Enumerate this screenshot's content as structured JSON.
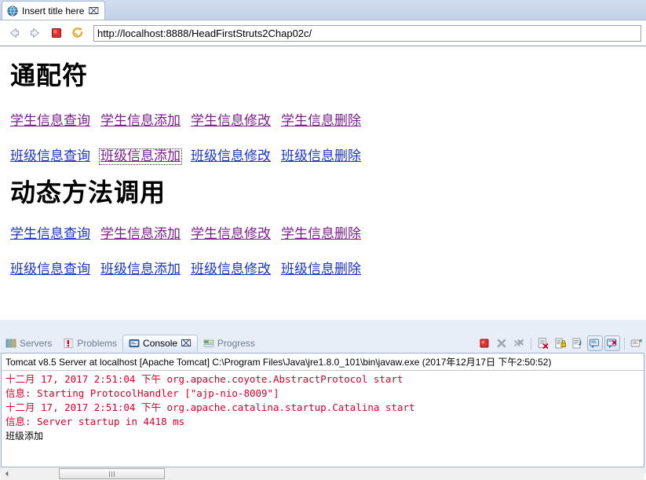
{
  "browser": {
    "tab_title": "Insert title here",
    "tab_close_glyph": "⌧",
    "url": "http://localhost:8888/HeadFirstStruts2Chap02c/",
    "toolbar": {
      "back_label": "Back",
      "forward_label": "Forward",
      "stop_label": "Stop",
      "refresh_label": "Refresh"
    }
  },
  "page": {
    "heading1": "通配符",
    "heading2": "动态方法调用",
    "rows": [
      {
        "id": "wildcard-student",
        "links": [
          {
            "text": "学生信息查询",
            "state": "visited",
            "focused": false
          },
          {
            "text": "学生信息添加",
            "state": "visited",
            "focused": false
          },
          {
            "text": "学生信息修改",
            "state": "visited",
            "focused": false
          },
          {
            "text": "学生信息删除",
            "state": "visited",
            "focused": false
          }
        ]
      },
      {
        "id": "wildcard-class",
        "links": [
          {
            "text": "班级信息查询",
            "state": "unvisited",
            "focused": false
          },
          {
            "text": "班级信息添加",
            "state": "visited",
            "focused": true
          },
          {
            "text": "班级信息修改",
            "state": "unvisited",
            "focused": false
          },
          {
            "text": "班级信息删除",
            "state": "unvisited",
            "focused": false
          }
        ]
      },
      {
        "id": "dmi-student",
        "links": [
          {
            "text": "学生信息查询",
            "state": "unvisited",
            "focused": false
          },
          {
            "text": "学生信息添加",
            "state": "visited",
            "focused": false
          },
          {
            "text": "学生信息修改",
            "state": "visited",
            "focused": false
          },
          {
            "text": "学生信息删除",
            "state": "visited",
            "focused": false
          }
        ]
      },
      {
        "id": "dmi-class",
        "links": [
          {
            "text": "班级信息查询",
            "state": "unvisited",
            "focused": false
          },
          {
            "text": "班级信息添加",
            "state": "unvisited",
            "focused": false
          },
          {
            "text": "班级信息修改",
            "state": "unvisited",
            "focused": false
          },
          {
            "text": "班级信息删除",
            "state": "unvisited",
            "focused": false
          }
        ]
      }
    ],
    "link_colors": {
      "unvisited": "#1a35c8",
      "visited": "#7d1f8e"
    }
  },
  "console_view": {
    "tabs": [
      {
        "label": "Servers",
        "icon": "servers-icon",
        "active": false
      },
      {
        "label": "Problems",
        "icon": "problems-icon",
        "active": false
      },
      {
        "label": "Console",
        "icon": "console-icon",
        "active": true
      },
      {
        "label": "Progress",
        "icon": "progress-icon",
        "active": false
      }
    ],
    "active_tab_close_glyph": "⌧",
    "toolbar": [
      {
        "name": "terminate-button",
        "label": "Terminate",
        "enabled": true,
        "toggled": false
      },
      {
        "name": "remove-launch-button",
        "label": "Remove Launch",
        "enabled": false,
        "toggled": false
      },
      {
        "name": "remove-all-terminated-button",
        "label": "Remove All Terminated Launches",
        "enabled": false,
        "toggled": false
      },
      {
        "name": "clear-console-button",
        "label": "Clear Console",
        "enabled": true,
        "toggled": false
      },
      {
        "name": "scroll-lock-button",
        "label": "Scroll Lock",
        "enabled": true,
        "toggled": false
      },
      {
        "name": "word-wrap-button",
        "label": "Word Wrap",
        "enabled": true,
        "toggled": false
      },
      {
        "name": "pin-console-button",
        "label": "Pin Console",
        "enabled": true,
        "toggled": true
      },
      {
        "name": "display-selected-console-button",
        "label": "Display Selected Console",
        "enabled": true,
        "toggled": true
      },
      {
        "name": "open-console-button",
        "label": "Open Console",
        "enabled": true,
        "toggled": false
      }
    ],
    "header": "Tomcat v8.5 Server at localhost [Apache Tomcat] C:\\Program Files\\Java\\jre1.8.0_101\\bin\\javaw.exe (2017年12月17日 下午2:50:52)",
    "log_lines": [
      {
        "text": "十二月 17, 2017 2:51:04 下午 org.apache.coyote.AbstractProtocol start",
        "stream": "err"
      },
      {
        "text": "信息: Starting ProtocolHandler [\"ajp-nio-8009\"]",
        "stream": "err"
      },
      {
        "text": "十二月 17, 2017 2:51:04 下午 org.apache.catalina.startup.Catalina start",
        "stream": "err"
      },
      {
        "text": "信息: Server startup in 4418 ms",
        "stream": "err"
      },
      {
        "text": "班级添加",
        "stream": "out"
      }
    ],
    "error_color": "#d4002a"
  }
}
